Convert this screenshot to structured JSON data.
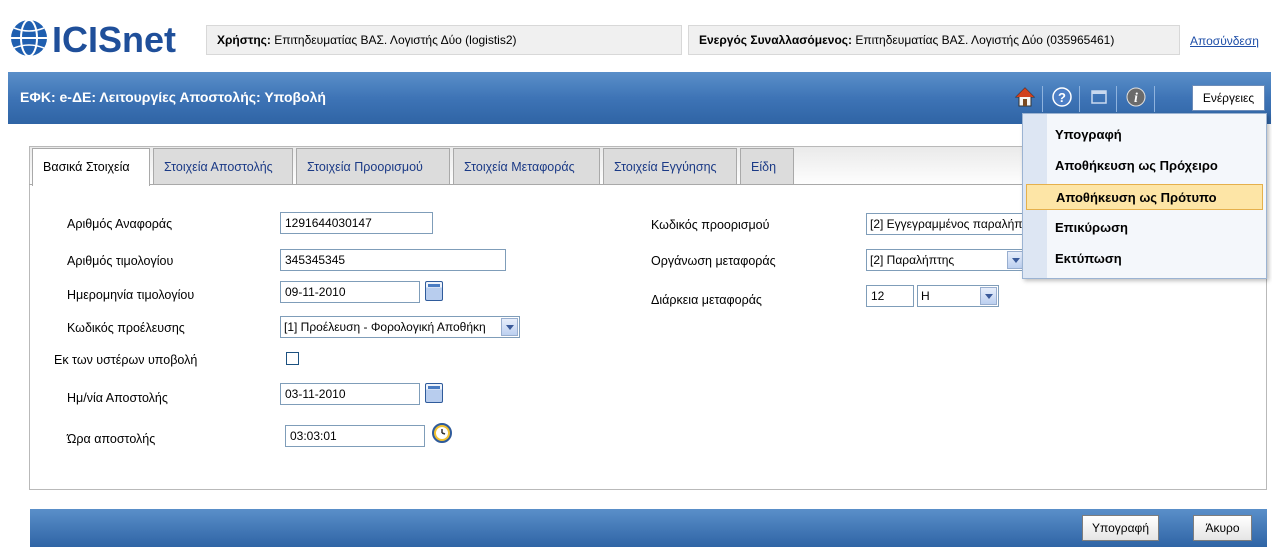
{
  "header": {
    "logo_text": "ICISnet",
    "user_label": "Χρήστης:",
    "user_value": "Επιτηδευματίας ΒΑΣ. Λογιστής Δύο (logistis2)",
    "trader_label": "Ενεργός Συναλλασόμενος:",
    "trader_value": "Επιτηδευματίας ΒΑΣ. Λογιστής Δύο (035965461)",
    "logout": "Αποσύνδεση"
  },
  "titlebar": {
    "title": "ΕΦΚ: e-ΔΕ: Λειτουργίες Αποστολής: Υποβολή",
    "actions_label": "Ενέργειες",
    "icons": [
      "home-icon",
      "help-icon",
      "window-icon",
      "info-icon"
    ]
  },
  "tabs": [
    {
      "label": "Βασικά Στοιχεία",
      "active": true
    },
    {
      "label": "Στοιχεία Αποστολής",
      "active": false
    },
    {
      "label": "Στοιχεία Προορισμού",
      "active": false
    },
    {
      "label": "Στοιχεία Μεταφοράς",
      "active": false
    },
    {
      "label": "Στοιχεία Εγγύησης",
      "active": false
    },
    {
      "label": "Είδη",
      "active": false
    }
  ],
  "form_left": {
    "ref_number": {
      "label": "Αριθμός Αναφοράς",
      "value": "1291644030147"
    },
    "invoice_number": {
      "label": "Αριθμός τιμολογίου",
      "value": "345345345"
    },
    "invoice_date": {
      "label": "Ημερομηνία τιμολογίου",
      "value": "09-11-2010"
    },
    "origin_code": {
      "label": "Κωδικός προέλευσης",
      "value": "[1] Προέλευση - Φορολογική Αποθήκη"
    },
    "deferred": {
      "label": "Εκ των υστέρων υποβολή",
      "checked": false
    },
    "dispatch_date": {
      "label": "Ημ/νία Αποστολής",
      "value": "03-11-2010"
    },
    "dispatch_time": {
      "label": "Ώρα αποστολής",
      "value": "03:03:01"
    }
  },
  "form_right": {
    "destination_code": {
      "label": "Κωδικός προορισμού",
      "value": "[2] Εγγεγραμμένος παραλήπ"
    },
    "transport_org": {
      "label": "Οργάνωση μεταφοράς",
      "value": "[2] Παραλήπτης"
    },
    "transport_duration": {
      "label": "Διάρκεια μεταφοράς",
      "value": "12",
      "unit": "H"
    }
  },
  "actions_menu": {
    "items": [
      "Υπογραφή",
      "Αποθήκευση ως Πρόχειρο",
      "Αποθήκευση ως Πρότυπο",
      "Επικύρωση",
      "Εκτύπωση"
    ],
    "highlighted_index": 2
  },
  "footer": {
    "sign_button": "Υπογραφή",
    "cancel_button": "Άκυρο"
  },
  "colors": {
    "bar_blue": "#3e74b6",
    "link_blue": "#1f4fa8",
    "menu_highlight": "#fde5a6"
  }
}
